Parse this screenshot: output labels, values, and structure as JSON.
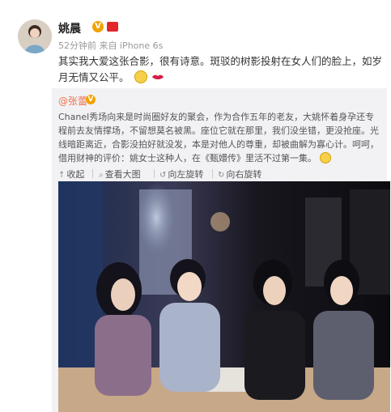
{
  "post": {
    "author": "姚晨",
    "meta_time": "52分钟前",
    "meta_source_prefix": "来自",
    "meta_source": "iPhone 6s",
    "text": "其实我大爱这张合影，很有诗意。斑驳的树影投射在女人们的脸上，如岁月无情又公平。"
  },
  "repost": {
    "author": "@张蕾",
    "text": "Chanel秀场向来是时尚圈好友的聚会，作为合作五年的老友，大姚怀着身孕还专程前去友情撑场，不留想莫名被黑。座位它就在那里，我们没坐错，更没抢座。光线暗距离近，合影没拍好就没发，本是对他人的尊重，却被曲解为寡心计。呵呵，借用财神的评价：姚女士这种人，在《甄嬛传》里活不过第一集。",
    "toolbar": {
      "collect": "收起",
      "view_large": "查看大图",
      "rotate_left": "向左旋转",
      "rotate_right": "向右旋转"
    }
  },
  "icons": {
    "verified": "v-badge-icon",
    "level": "weibo-level-icon",
    "emoji1": "grin-emoji-icon",
    "emoji2": "lips-emoji-icon",
    "emoji3": "smile-emoji-icon"
  },
  "colors": {
    "link": "#eb7350",
    "repost_bg": "#f2f2f5",
    "badge": "#f2a200"
  }
}
